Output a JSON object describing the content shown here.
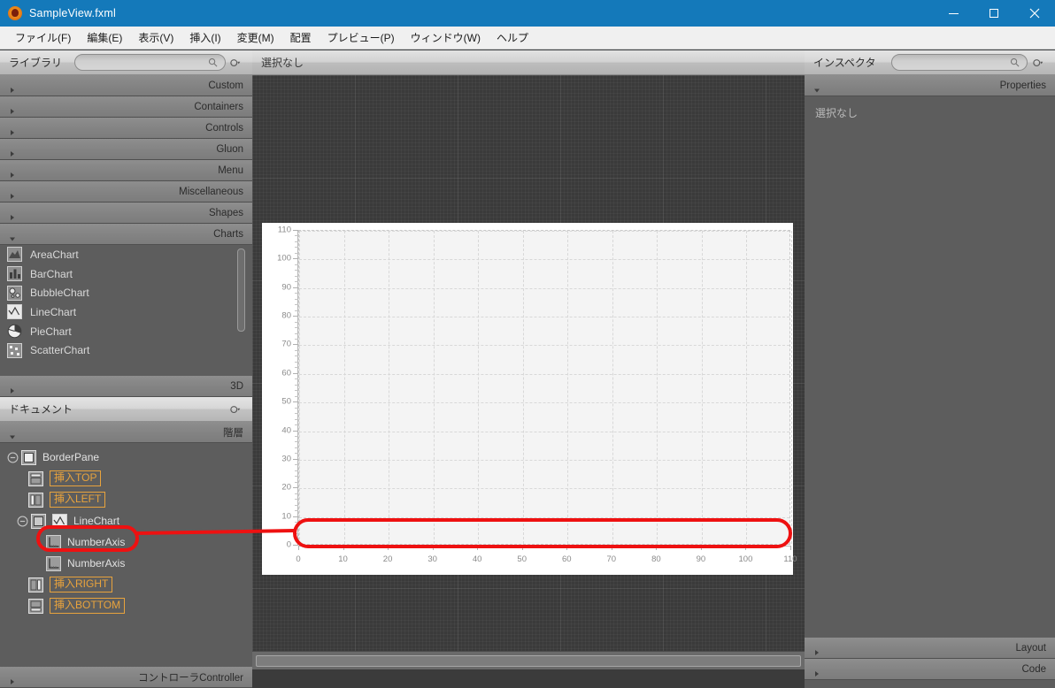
{
  "window": {
    "title": "SampleView.fxml",
    "icon": "app-icon",
    "controls": {
      "minimize": "minimize",
      "maximize": "maximize",
      "close": "close"
    }
  },
  "menubar": {
    "items": [
      {
        "label": "ファイル(F)",
        "name": "menu-file"
      },
      {
        "label": "編集(E)",
        "name": "menu-edit"
      },
      {
        "label": "表示(V)",
        "name": "menu-view"
      },
      {
        "label": "挿入(I)",
        "name": "menu-insert"
      },
      {
        "label": "変更(M)",
        "name": "menu-modify"
      },
      {
        "label": "配置",
        "name": "menu-arrange"
      },
      {
        "label": "プレビュー(P)",
        "name": "menu-preview"
      },
      {
        "label": "ウィンドウ(W)",
        "name": "menu-window"
      },
      {
        "label": "ヘルプ",
        "name": "menu-help"
      }
    ]
  },
  "library": {
    "title": "ライブラリ",
    "search_value": "",
    "search_placeholder": "",
    "sections": [
      {
        "label": "Custom",
        "expanded": false
      },
      {
        "label": "Containers",
        "expanded": false
      },
      {
        "label": "Controls",
        "expanded": false
      },
      {
        "label": "Gluon",
        "expanded": false
      },
      {
        "label": "Menu",
        "expanded": false
      },
      {
        "label": "Miscellaneous",
        "expanded": false
      },
      {
        "label": "Shapes",
        "expanded": false
      },
      {
        "label": "Charts",
        "expanded": true
      }
    ],
    "chart_items": [
      {
        "label": "AreaChart",
        "icon": "area-chart-icon"
      },
      {
        "label": "BarChart",
        "icon": "bar-chart-icon"
      },
      {
        "label": "BubbleChart",
        "icon": "bubble-chart-icon"
      },
      {
        "label": "LineChart",
        "icon": "line-chart-icon"
      },
      {
        "label": "PieChart",
        "icon": "pie-chart-icon"
      },
      {
        "label": "ScatterChart",
        "icon": "scatter-chart-icon"
      }
    ],
    "trailing_section": {
      "label": "3D",
      "expanded": false
    }
  },
  "document": {
    "title": "ドキュメント",
    "hierarchy_label": "階層",
    "controller_label": "コントローラController",
    "tree": [
      {
        "label": "BorderPane",
        "depth": 0,
        "expander": "minus",
        "icon": "borderpane-icon",
        "tag": false,
        "highlight": false
      },
      {
        "label": "挿入TOP",
        "depth": 1,
        "expander": "none",
        "icon": "region-top-icon",
        "tag": true,
        "highlight": false
      },
      {
        "label": "挿入LEFT",
        "depth": 1,
        "expander": "none",
        "icon": "region-left-icon",
        "tag": true,
        "highlight": false
      },
      {
        "label": "LineChart",
        "depth": 1,
        "expander": "minus",
        "icon": "line-chart-icon",
        "tag": false,
        "highlight": false
      },
      {
        "label": "NumberAxis",
        "depth": 2,
        "expander": "none",
        "icon": "axis-icon",
        "tag": false,
        "highlight": true
      },
      {
        "label": "NumberAxis",
        "depth": 2,
        "expander": "none",
        "icon": "axis-icon",
        "tag": false,
        "highlight": false
      },
      {
        "label": "挿入RIGHT",
        "depth": 1,
        "expander": "none",
        "icon": "region-right-icon",
        "tag": true,
        "highlight": false
      },
      {
        "label": "挿入BOTTOM",
        "depth": 1,
        "expander": "none",
        "icon": "region-bottom-icon",
        "tag": true,
        "highlight": false
      }
    ]
  },
  "canvas": {
    "selection_status": "選択なし"
  },
  "inspector": {
    "title": "インスペクタ",
    "search_value": "",
    "search_placeholder": "",
    "sections": [
      {
        "label": "Properties",
        "expanded": true
      },
      {
        "label": "Layout",
        "expanded": false
      },
      {
        "label": "Code",
        "expanded": false
      }
    ],
    "empty_message": "選択なし"
  },
  "annotation": {
    "color": "#ee1111",
    "target": "x-axis-numberaxis",
    "source": "tree-node-numberaxis"
  },
  "chart_data": {
    "type": "line",
    "title": "",
    "xlabel": "",
    "ylabel": "",
    "series": [],
    "x_ticks": [
      0,
      10,
      20,
      30,
      40,
      50,
      60,
      70,
      80,
      90,
      100,
      110
    ],
    "y_ticks": [
      0,
      10,
      20,
      30,
      40,
      50,
      60,
      70,
      80,
      90,
      100,
      110
    ],
    "xlim": [
      0,
      110
    ],
    "ylim": [
      0,
      110
    ],
    "grid": true,
    "legend": "none",
    "minor_ticks_per_major": 5
  }
}
